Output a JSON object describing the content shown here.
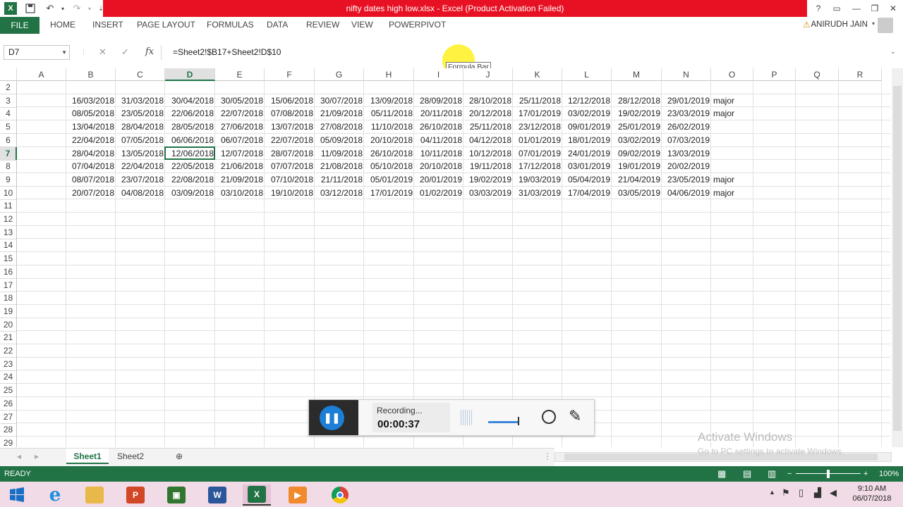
{
  "window": {
    "title": "nifty dates high low.xlsx -  Excel (Product Activation Failed)",
    "help": "?",
    "accent": "#217346",
    "title_band_color": "#e81123"
  },
  "ribbon": {
    "tabs": [
      "FILE",
      "HOME",
      "INSERT",
      "PAGE LAYOUT",
      "FORMULAS",
      "DATA",
      "REVIEW",
      "VIEW",
      "POWERPIVOT"
    ],
    "user": "ANIRUDH JAIN"
  },
  "formula_bar": {
    "name_box": "D7",
    "fx": "fx",
    "formula": "=Sheet2!$B17+Sheet2!D$10",
    "tooltip": "Formula Bar"
  },
  "sheet": {
    "columns": [
      "A",
      "B",
      "C",
      "D",
      "E",
      "F",
      "G",
      "H",
      "I",
      "J",
      "K",
      "L",
      "M",
      "N",
      "O",
      "P",
      "Q",
      "R"
    ],
    "row_numbers": [
      "2",
      "3",
      "4",
      "5",
      "6",
      "7",
      "8",
      "9",
      "10",
      "11",
      "12",
      "13",
      "14",
      "15",
      "16",
      "17",
      "18",
      "19",
      "20",
      "21",
      "22",
      "23",
      "24",
      "25",
      "26",
      "27",
      "28",
      "29"
    ],
    "selected_column": "D",
    "selected_row": "7",
    "data_rows": [
      {
        "row": "3",
        "dates": [
          "16/03/2018",
          "31/03/2018",
          "30/04/2018",
          "30/05/2018",
          "15/06/2018",
          "30/07/2018",
          "13/09/2018",
          "28/09/2018",
          "28/10/2018",
          "25/11/2018",
          "12/12/2018",
          "28/12/2018",
          "29/01/2019"
        ],
        "note": "major"
      },
      {
        "row": "4",
        "dates": [
          "08/05/2018",
          "23/05/2018",
          "22/06/2018",
          "22/07/2018",
          "07/08/2018",
          "21/09/2018",
          "05/11/2018",
          "20/11/2018",
          "20/12/2018",
          "17/01/2019",
          "03/02/2019",
          "19/02/2019",
          "23/03/2019"
        ],
        "note": "major"
      },
      {
        "row": "5",
        "dates": [
          "13/04/2018",
          "28/04/2018",
          "28/05/2018",
          "27/06/2018",
          "13/07/2018",
          "27/08/2018",
          "11/10/2018",
          "26/10/2018",
          "25/11/2018",
          "23/12/2018",
          "09/01/2019",
          "25/01/2019",
          "26/02/2019"
        ],
        "note": ""
      },
      {
        "row": "6",
        "dates": [
          "22/04/2018",
          "07/05/2018",
          "06/06/2018",
          "06/07/2018",
          "22/07/2018",
          "05/09/2018",
          "20/10/2018",
          "04/11/2018",
          "04/12/2018",
          "01/01/2019",
          "18/01/2019",
          "03/02/2019",
          "07/03/2019"
        ],
        "note": ""
      },
      {
        "row": "7",
        "dates": [
          "28/04/2018",
          "13/05/2018",
          "12/06/2018",
          "12/07/2018",
          "28/07/2018",
          "11/09/2018",
          "26/10/2018",
          "10/11/2018",
          "10/12/2018",
          "07/01/2019",
          "24/01/2019",
          "09/02/2019",
          "13/03/2019"
        ],
        "note": ""
      },
      {
        "row": "8",
        "dates": [
          "07/04/2018",
          "22/04/2018",
          "22/05/2018",
          "21/06/2018",
          "07/07/2018",
          "21/08/2018",
          "05/10/2018",
          "20/10/2018",
          "19/11/2018",
          "17/12/2018",
          "03/01/2019",
          "19/01/2019",
          "20/02/2019"
        ],
        "note": ""
      },
      {
        "row": "9",
        "dates": [
          "08/07/2018",
          "23/07/2018",
          "22/08/2018",
          "21/09/2018",
          "07/10/2018",
          "21/11/2018",
          "05/01/2019",
          "20/01/2019",
          "19/02/2019",
          "19/03/2019",
          "05/04/2019",
          "21/04/2019",
          "23/05/2019"
        ],
        "note": "major"
      },
      {
        "row": "10",
        "dates": [
          "20/07/2018",
          "04/08/2018",
          "03/09/2018",
          "03/10/2018",
          "19/10/2018",
          "03/12/2018",
          "17/01/2019",
          "01/02/2019",
          "03/03/2019",
          "31/03/2019",
          "17/04/2019",
          "03/05/2019",
          "04/06/2019"
        ],
        "note": "major"
      }
    ]
  },
  "sheet_tabs": [
    "Sheet1",
    "Sheet2"
  ],
  "status_bar": {
    "ready": "READY",
    "zoom": "100%"
  },
  "recorder": {
    "status": "Recording...",
    "time": "00:00:37"
  },
  "watermark": {
    "line1": "Activate Windows",
    "line2": "Go to PC settings to activate Windows."
  },
  "taskbar": {
    "time": "9:10 AM",
    "date": "06/07/2018",
    "apps": [
      "start-icon",
      "internet-explorer-icon",
      "file-explorer-icon",
      "powerpoint-icon",
      "project-icon",
      "word-icon",
      "excel-icon",
      "media-player-icon",
      "chrome-icon"
    ]
  }
}
